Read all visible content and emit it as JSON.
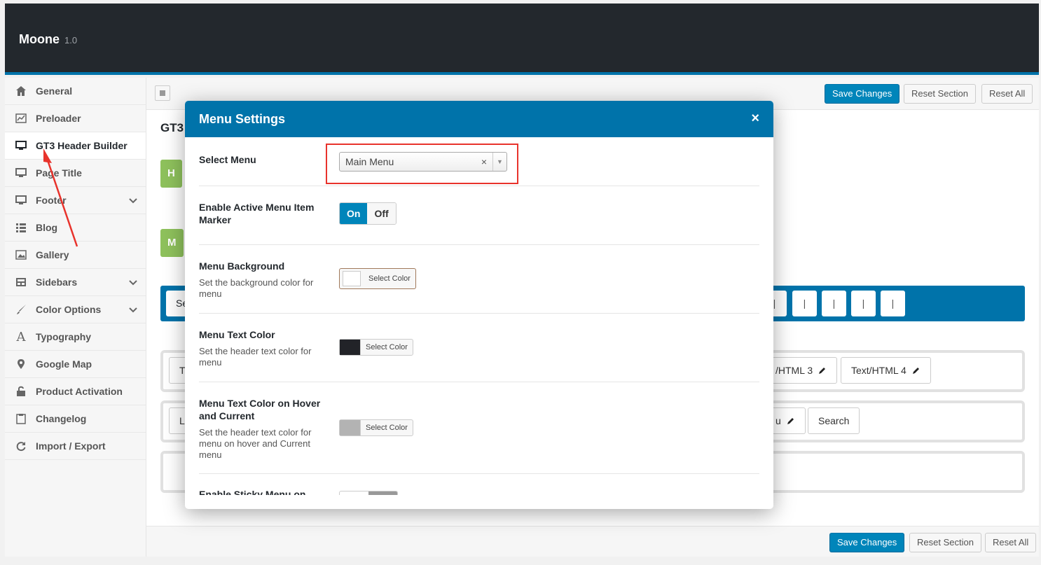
{
  "app": {
    "title": "Moone",
    "version": "1.0"
  },
  "sidebar": {
    "items": [
      {
        "label": "General",
        "icon": "home-icon"
      },
      {
        "label": "Preloader",
        "icon": "chart-icon"
      },
      {
        "label": "GT3 Header Builder",
        "icon": "monitor-icon",
        "active": true
      },
      {
        "label": "Page Title",
        "icon": "monitor-icon"
      },
      {
        "label": "Footer",
        "icon": "monitor-icon",
        "expandable": true
      },
      {
        "label": "Blog",
        "icon": "list-icon"
      },
      {
        "label": "Gallery",
        "icon": "image-icon"
      },
      {
        "label": "Sidebars",
        "icon": "sidebar-icon",
        "expandable": true
      },
      {
        "label": "Color Options",
        "icon": "brush-icon",
        "expandable": true
      },
      {
        "label": "Typography",
        "icon": "font-icon"
      },
      {
        "label": "Google Map",
        "icon": "pin-icon"
      },
      {
        "label": "Product Activation",
        "icon": "unlock-icon"
      },
      {
        "label": "Changelog",
        "icon": "clipboard-icon"
      },
      {
        "label": "Import / Export",
        "icon": "refresh-icon"
      }
    ]
  },
  "toolbar": {
    "save": "Save Changes",
    "reset_section": "Reset Section",
    "reset_all": "Reset All"
  },
  "background": {
    "heading_frag": "GT3",
    "green1_frag": "H",
    "green2_frag": "M",
    "bar_frag": "Se",
    "row1_frag": "T",
    "row2_frag": "L",
    "tag_html3": "/HTML 3",
    "tag_html4": "Text/HTML 4",
    "tag_menu_frag": "u",
    "tag_search": "Search",
    "pill_char": "|"
  },
  "modal": {
    "title": "Menu Settings",
    "close": "×",
    "select_menu": {
      "label": "Select Menu",
      "value": "Main Menu",
      "clear": "×",
      "arrow": "▼"
    },
    "active_marker": {
      "label": "Enable Active Menu Item Marker",
      "on": "On",
      "off": "Off",
      "value": "On"
    },
    "menu_bg": {
      "label": "Menu Background",
      "desc": "Set the background color for menu",
      "button": "Select Color",
      "color": "#ffffff"
    },
    "menu_text": {
      "label": "Menu Text Color",
      "desc": "Set the header text color for menu",
      "button": "Select Color",
      "color": "#222328"
    },
    "menu_hover": {
      "label": "Menu Text Color on Hover and Current",
      "desc": "Set the header text color for menu on hover and Current menu",
      "button": "Select Color",
      "color": "#b3b3b3"
    },
    "sticky": {
      "label": "Enable Sticky Menu on"
    }
  },
  "colors": {
    "accent": "#0073aa",
    "primary_button": "#0085ba",
    "header_bg": "#23282d",
    "green": "#8ec15c",
    "annotation_red": "#e8332c"
  }
}
